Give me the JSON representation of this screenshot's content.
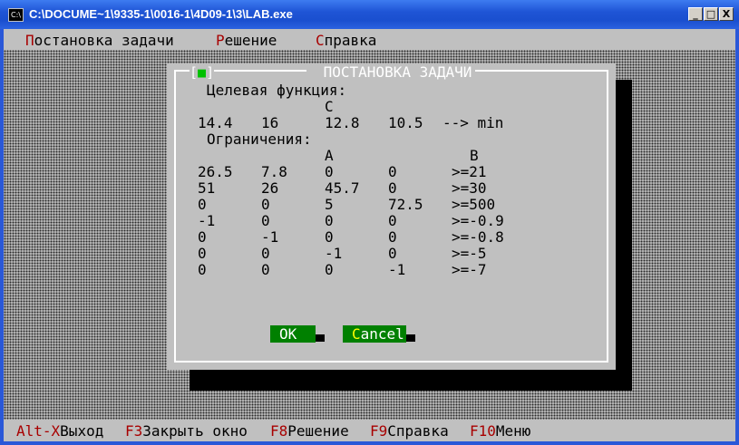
{
  "window": {
    "title": "C:\\DOCUME~1\\9335-1\\0016-1\\4D09-1\\3\\LAB.exe",
    "icon": "console-app-icon",
    "minimize_label": "_",
    "maximize_label": "□",
    "close_label": "X"
  },
  "menubar": {
    "items": [
      {
        "hot": "П",
        "rest": "остановка задачи"
      },
      {
        "hot": "Р",
        "rest": "ешение"
      },
      {
        "hot": "С",
        "rest": "правка"
      }
    ]
  },
  "dialog": {
    "title": " ПОСТАНОВКА ЗАДАЧИ ",
    "close_open": "[",
    "close_mark": "■",
    "close_end": "]",
    "objective_label": "Целевая функция:",
    "c_header": "C",
    "c_values": [
      "14.4",
      "16",
      "12.8",
      "10.5"
    ],
    "direction": "--> min",
    "constraints_label": "Ограничения:",
    "a_header": "A",
    "b_header": "B",
    "rows": [
      [
        "26.5",
        "7.8",
        "0",
        "0",
        ">=21"
      ],
      [
        "51",
        "26",
        "45.7",
        "0",
        ">=30"
      ],
      [
        "0",
        "0",
        "5",
        "72.5",
        ">=500"
      ],
      [
        "-1",
        "0",
        "0",
        "0",
        ">=-0.9"
      ],
      [
        "0",
        "-1",
        "0",
        "0",
        ">=-0.8"
      ],
      [
        "0",
        "0",
        "-1",
        "0",
        ">=-5"
      ],
      [
        "0",
        "0",
        "0",
        "-1",
        ">=-7"
      ]
    ],
    "ok_label": "OK",
    "cancel_hot": "C",
    "cancel_rest": "ancel"
  },
  "statusbar": {
    "items": [
      {
        "key": "Alt-X",
        "label": "Выход"
      },
      {
        "key": "F3",
        "label": "Закрыть окно"
      },
      {
        "key": "F8",
        "label": "Решение"
      },
      {
        "key": "F9",
        "label": "Справка"
      },
      {
        "key": "F10",
        "label": "Меню"
      }
    ]
  }
}
